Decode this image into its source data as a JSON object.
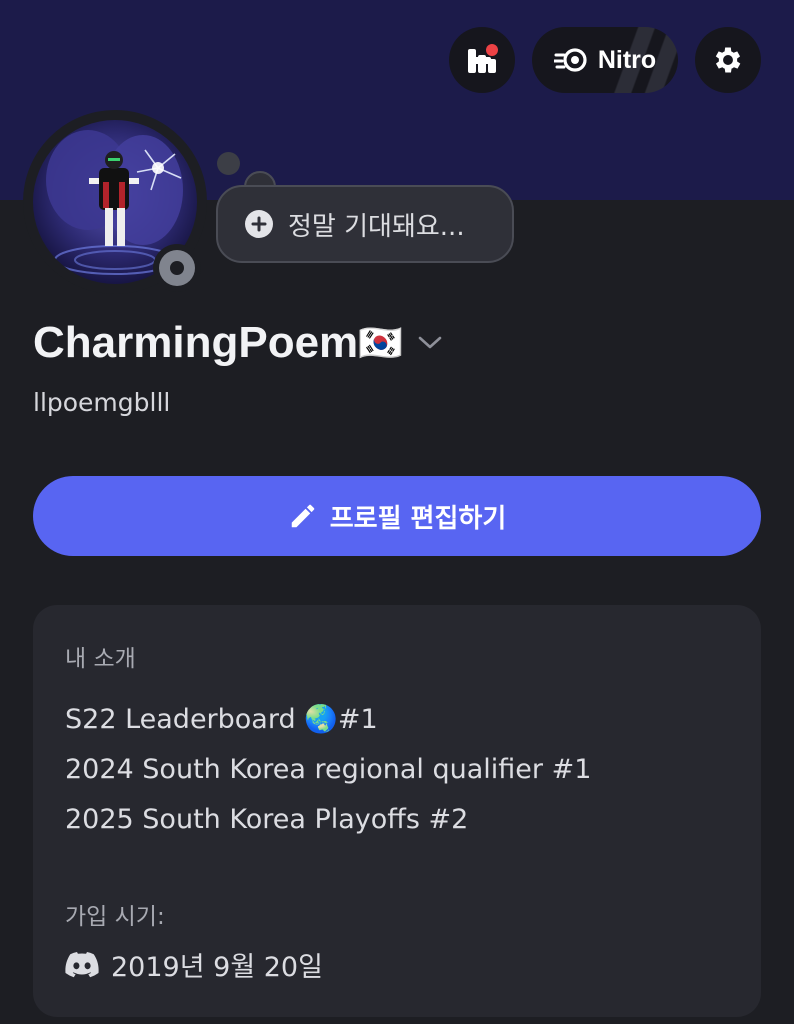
{
  "header": {
    "nitro_label": "Nitro"
  },
  "status_bubble": {
    "text": "정말 기대돼요..."
  },
  "profile": {
    "display_name": "CharmingPoem",
    "flag": "🇰🇷",
    "username": "llpoemgblll"
  },
  "actions": {
    "edit_profile_label": "프로필 편집하기"
  },
  "about": {
    "label": "내 소개",
    "lines": [
      "S22 Leaderboard 🌏#1",
      "2024 South Korea regional qualifier #1",
      "2025 South Korea Playoffs #2"
    ]
  },
  "member_since": {
    "label": "가입 시기:",
    "date": "2019년 9월 20일"
  },
  "colors": {
    "banner": "#1c1b4a",
    "background": "#1d1e23",
    "card": "#27282f",
    "accent": "#5865f2"
  },
  "icons": [
    "quests-icon",
    "nitro-icon",
    "gear-icon",
    "plus-circle-icon",
    "chevron-down-icon",
    "pencil-icon",
    "discord-icon"
  ]
}
